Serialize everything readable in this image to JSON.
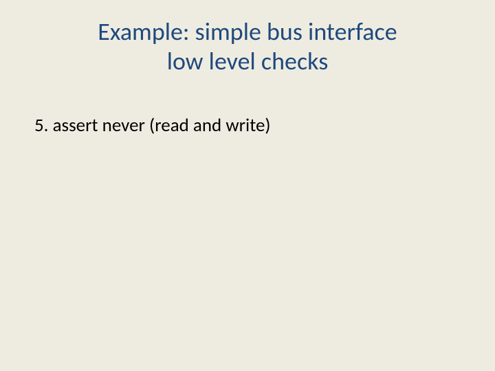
{
  "slide": {
    "title_line1": "Example: simple bus interface",
    "title_line2": "low level checks",
    "body_item": "5. assert  never (read and write)"
  },
  "colors": {
    "background": "#eeece1",
    "title": "#1f497d",
    "body": "#000000"
  }
}
